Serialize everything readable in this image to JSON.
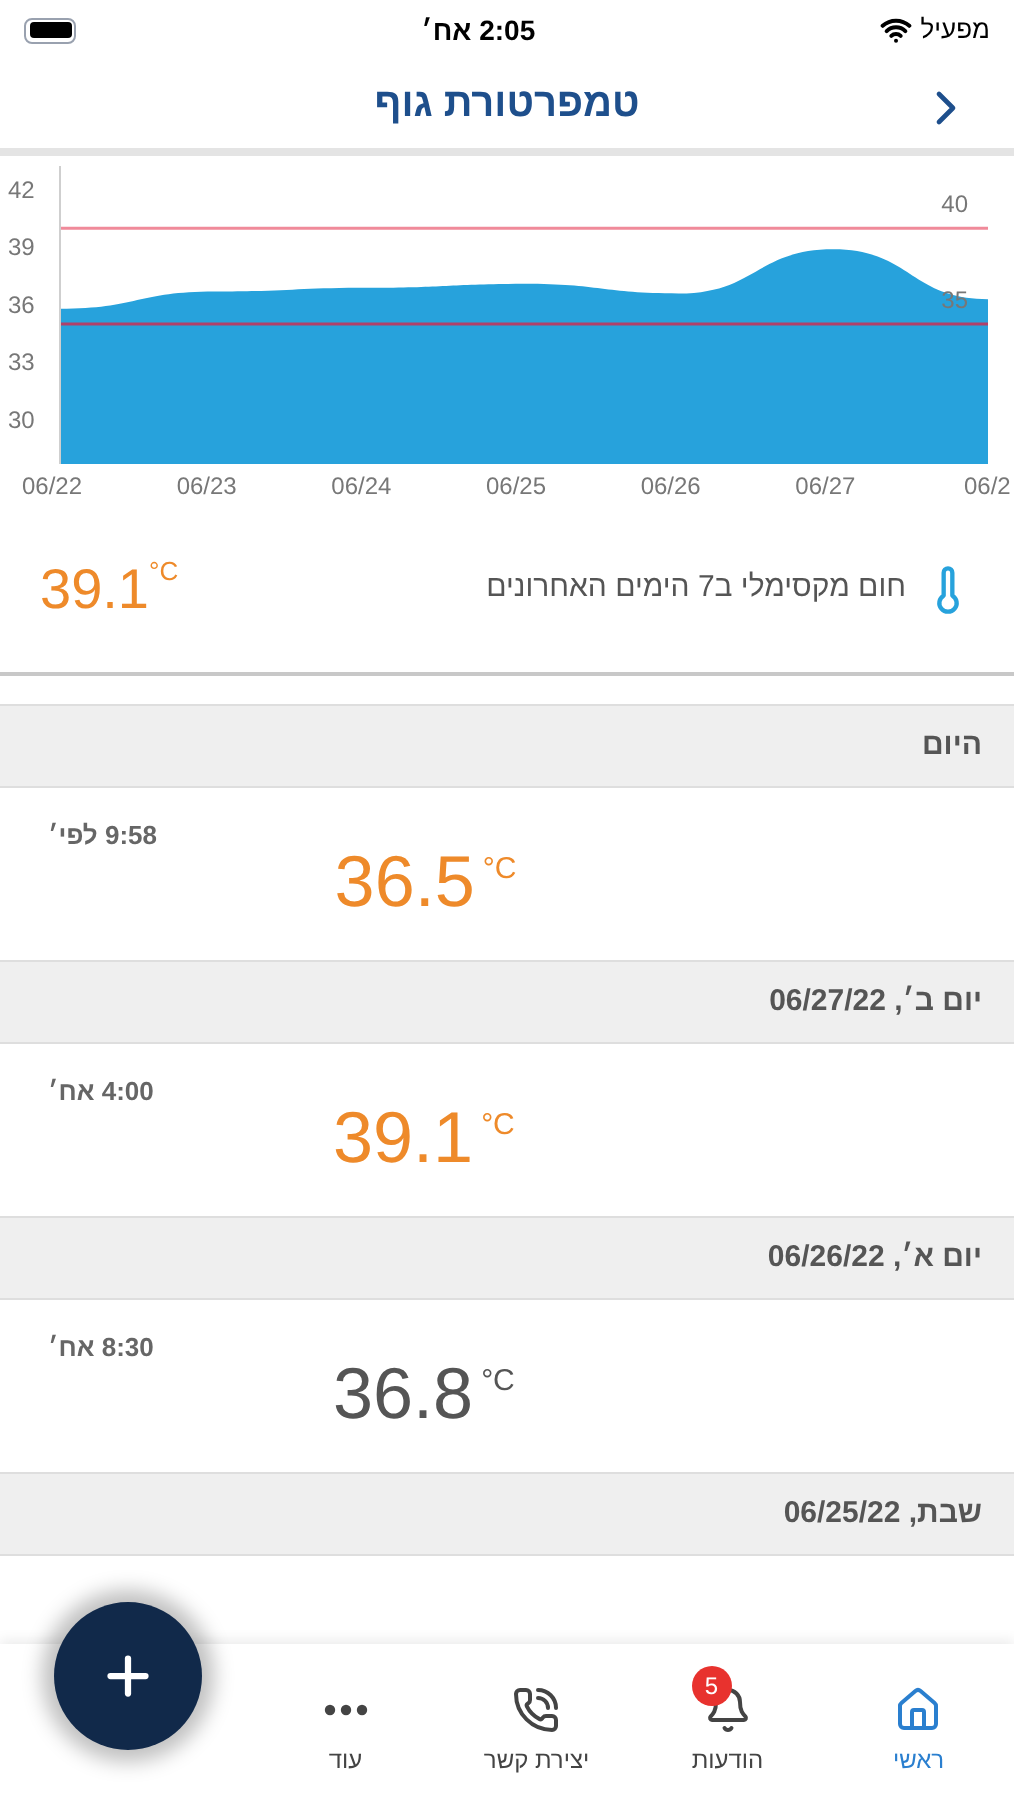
{
  "status_bar": {
    "carrier": "מפעיל",
    "time": "2:05 אח׳"
  },
  "header": {
    "title": "טמפרטורת גוף"
  },
  "chart": {
    "chart_data": {
      "type": "area",
      "categories": [
        "06/22",
        "06/23",
        "06/24",
        "06/25",
        "06/26",
        "06/27",
        "06/2"
      ],
      "series": [
        {
          "color": "#27a2dc",
          "values": [
            35.8,
            36.7,
            36.9,
            37.1,
            36.6,
            38.9,
            36.3
          ]
        }
      ],
      "ylim": [
        27.7,
        43.25
      ],
      "yticks": [
        30,
        33,
        36,
        39,
        42
      ],
      "ref_lines": [
        {
          "axis": "y",
          "value": 40,
          "label": "40",
          "color": "#f08a9a"
        },
        {
          "axis": "y",
          "value": 35,
          "label": "35",
          "color": "#b0406a"
        }
      ]
    }
  },
  "max_summary": {
    "label": "חום מקסימלי ב7 הימים האחרונים",
    "value": "39.1",
    "unit": "°C"
  },
  "days": [
    {
      "header": "היום",
      "readings": [
        {
          "time": "9:58 לפי׳",
          "value": "36.5",
          "unit": "°C",
          "color": "#ee8a2a"
        }
      ]
    },
    {
      "header": "יום ב׳, 06/27/22",
      "readings": [
        {
          "time": "4:00 אח׳",
          "value": "39.1",
          "unit": "°C",
          "color": "#ee8a2a"
        }
      ]
    },
    {
      "header": "יום א׳, 06/26/22",
      "readings": [
        {
          "time": "8:30 אח׳",
          "value": "36.8",
          "unit": "°C",
          "color": "#555555"
        }
      ]
    },
    {
      "header": "שבת, 06/25/22"
    }
  ],
  "nav": [
    {
      "kind": "home",
      "label": "ראשי",
      "selected": true
    },
    {
      "kind": "bell",
      "label": "הודעות",
      "selected": false,
      "badge": "5"
    },
    {
      "kind": "contact",
      "label": "יצירת קשר",
      "selected": false
    },
    {
      "kind": "more",
      "label": "עוד",
      "selected": false
    }
  ]
}
